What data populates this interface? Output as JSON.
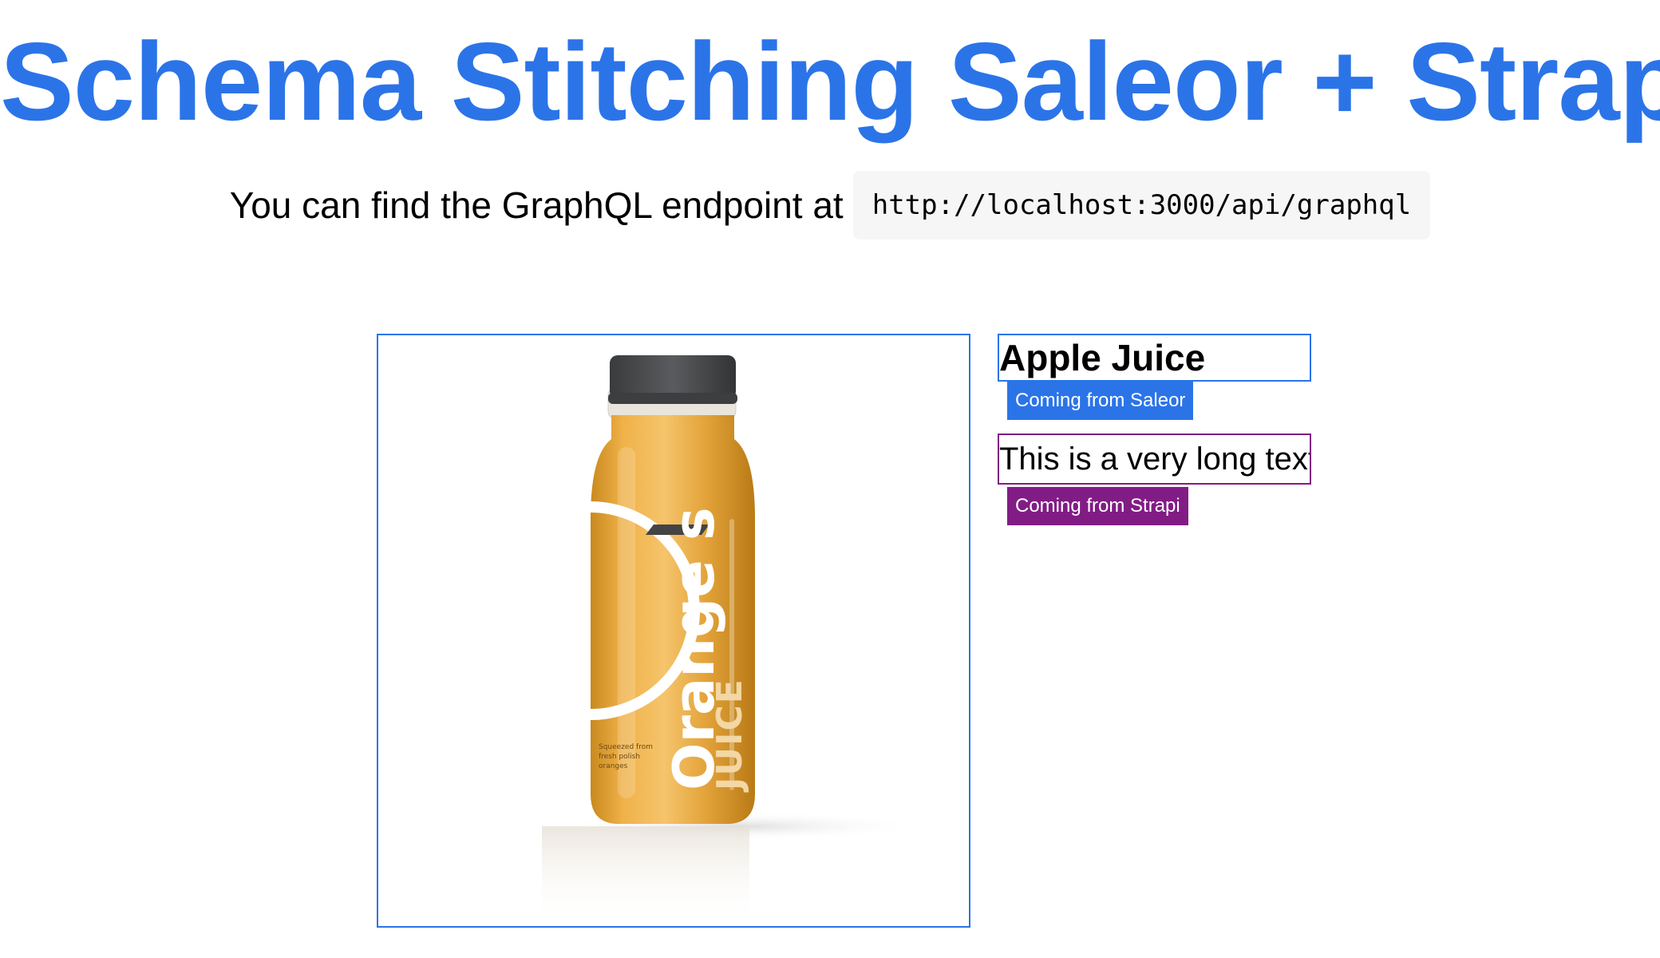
{
  "header": {
    "title": "Schema Stitching Saleor + Strapi",
    "endpoint_text": "You can find the GraphQL endpoint at",
    "endpoint_url": "http://localhost:3000/api/graphql"
  },
  "product": {
    "name": "Apple Juice",
    "name_source_badge": "Coming from Saleor",
    "description": "This is a very long text",
    "description_source_badge": "Coming from Strapi",
    "image": {
      "label_big": "Orange s",
      "label_sub": "JUICE",
      "label_small_lines": [
        "Squeezed from",
        "fresh polish",
        "oranges"
      ]
    }
  },
  "colors": {
    "saleor_blue": "#2b74e8",
    "strapi_purple": "#821c85",
    "juice_orange": "#e0a138",
    "cap_gray": "#4a4b4d"
  }
}
